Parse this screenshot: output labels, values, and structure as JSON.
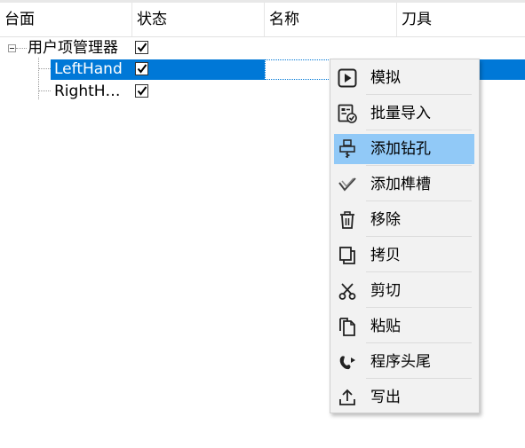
{
  "header": {
    "columns": [
      "台面",
      "状态",
      "名称",
      "刀具"
    ]
  },
  "tree": {
    "root": {
      "label": "用户项管理器",
      "checked": true
    },
    "children": [
      {
        "label": "LeftHand",
        "checked": true,
        "selected": true
      },
      {
        "label": "RightH…",
        "checked": true,
        "selected": false
      }
    ]
  },
  "context_menu": {
    "items": [
      {
        "label": "模拟",
        "icon": "play-icon"
      },
      {
        "label": "批量导入",
        "icon": "batch-import-icon"
      },
      {
        "label": "添加钻孔",
        "icon": "drill-icon",
        "highlighted": true
      },
      {
        "label": "添加榫槽",
        "icon": "mortise-icon"
      },
      {
        "label": "移除",
        "icon": "trash-icon"
      },
      {
        "label": "拷贝",
        "icon": "copy-icon"
      },
      {
        "label": "剪切",
        "icon": "scissors-icon"
      },
      {
        "label": "粘贴",
        "icon": "paste-icon"
      },
      {
        "label": "程序头尾",
        "icon": "program-head-tail-icon"
      },
      {
        "label": "写出",
        "icon": "export-icon"
      }
    ]
  },
  "colors": {
    "selection": "#0078d7",
    "menu_highlight": "#91c9f7",
    "menu_background": "#f2f2f2"
  }
}
